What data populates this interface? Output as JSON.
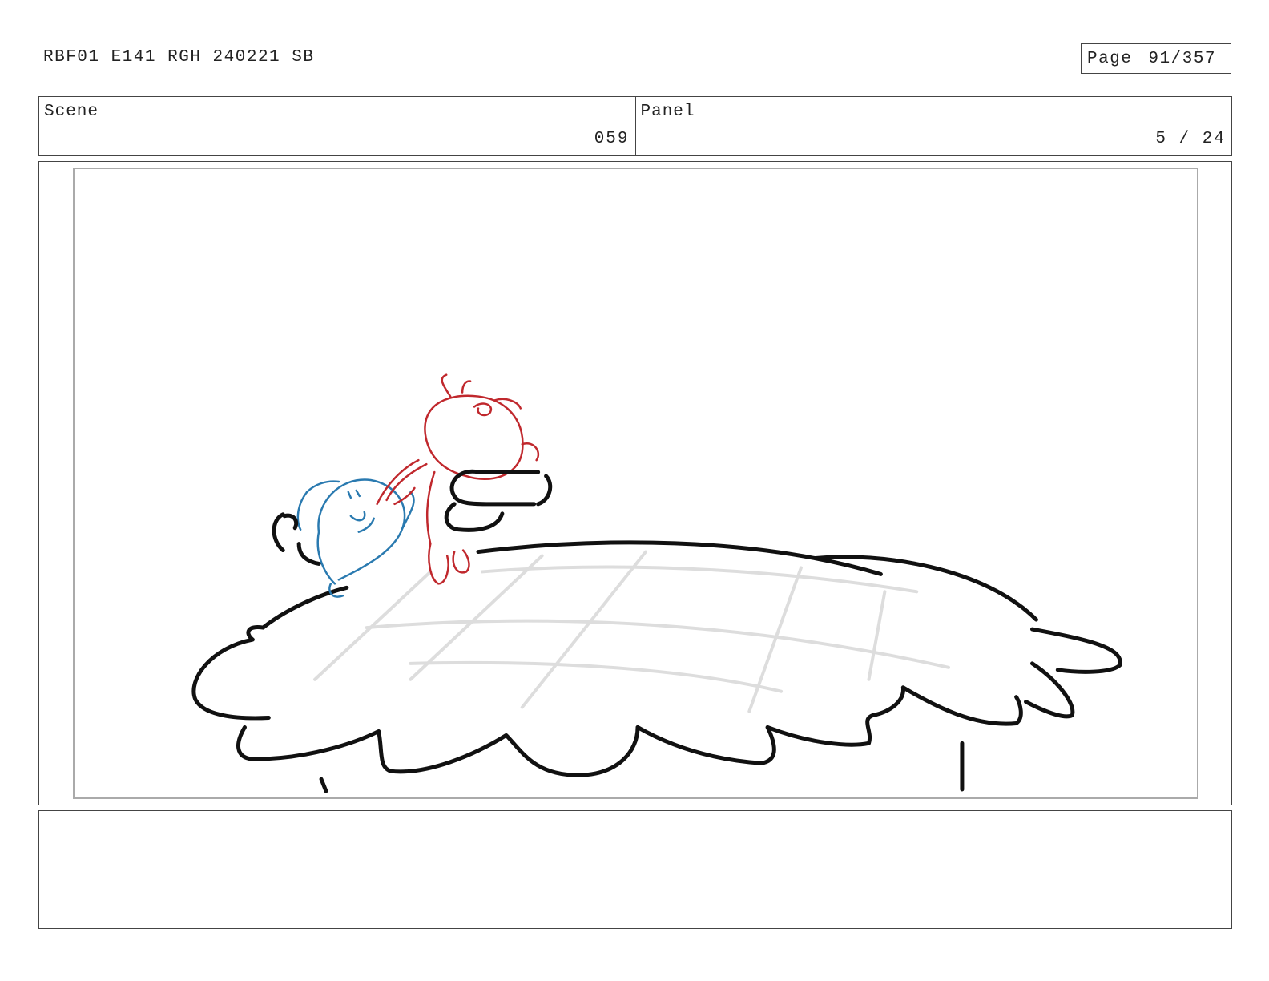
{
  "header": {
    "doc_title": "RBF01 E141 RGH 240221 SB",
    "page_label": "Page",
    "page_value": "91/357"
  },
  "scene": {
    "label": "Scene",
    "value": "059"
  },
  "panel": {
    "label": "Panel",
    "value": "5 / 24"
  },
  "colors": {
    "ink": "#111111",
    "grid": "#dddddd",
    "red_sketch": "#c0282d",
    "blue_sketch": "#2a7ab0"
  }
}
